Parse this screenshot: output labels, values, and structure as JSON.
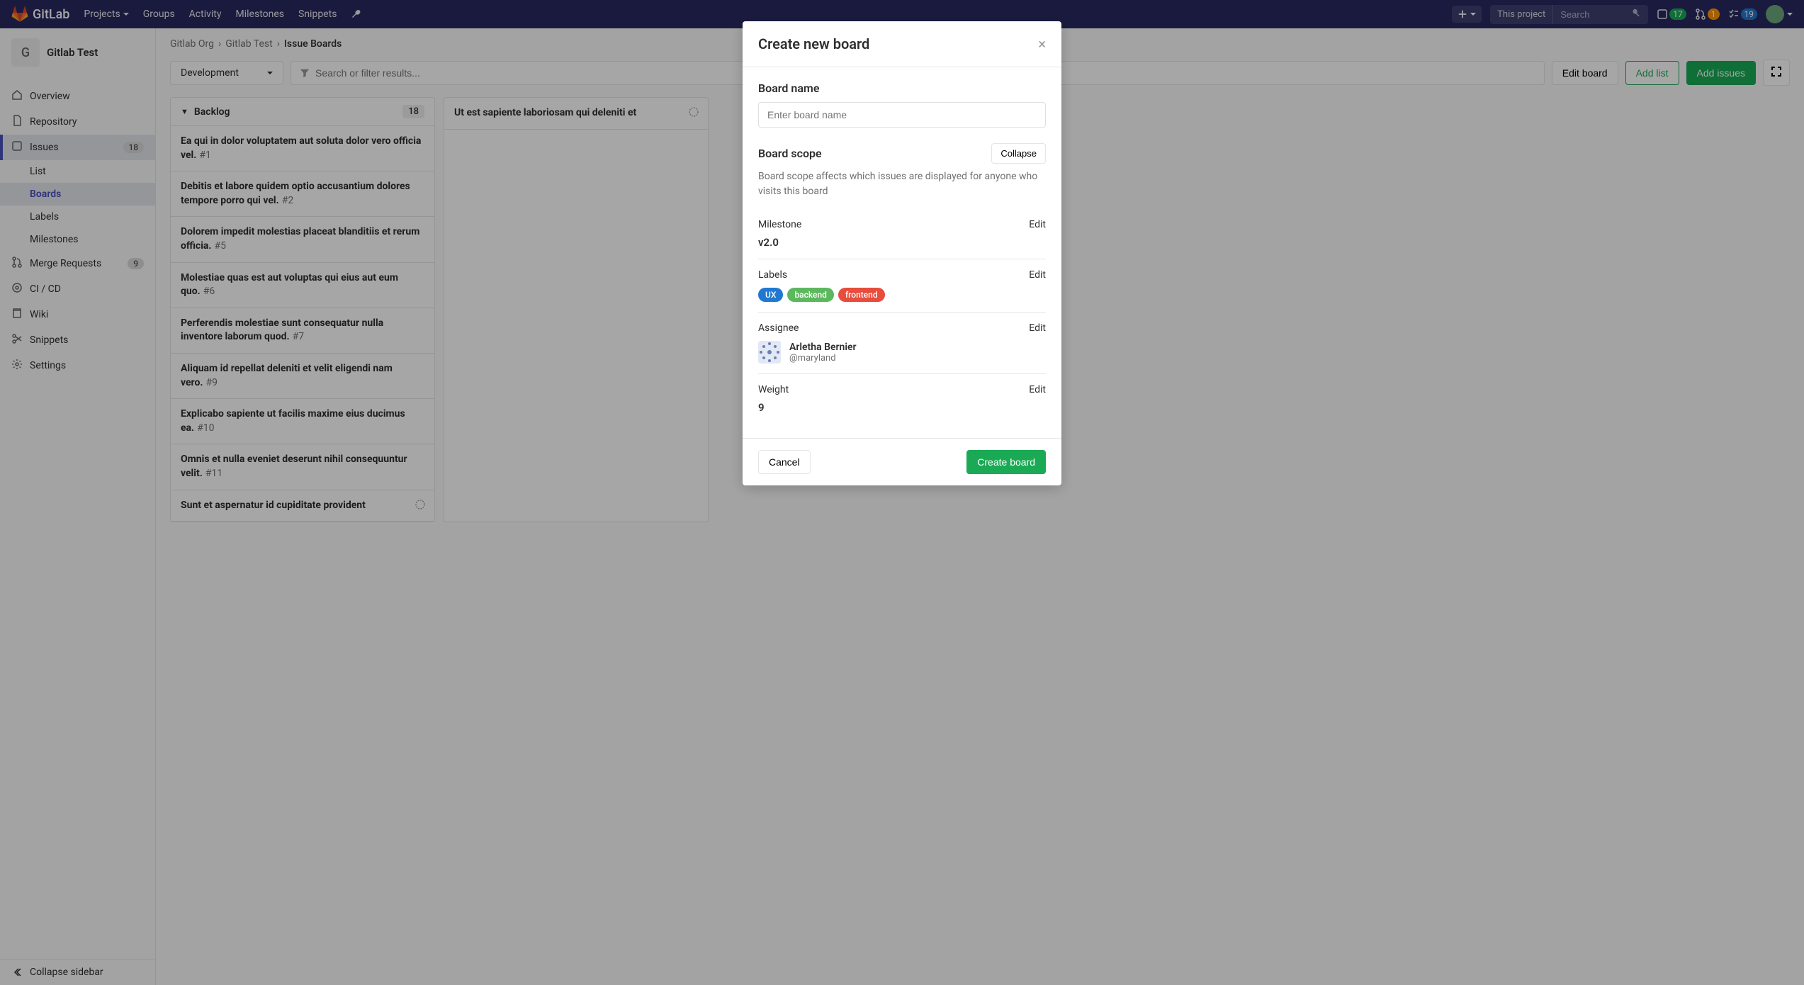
{
  "navbar": {
    "brand": "GitLab",
    "items": [
      "Projects",
      "Groups",
      "Activity",
      "Milestones",
      "Snippets"
    ],
    "search_scope": "This project",
    "search_placeholder": "Search",
    "badges": {
      "issues": "17",
      "merge": "1",
      "todos": "19"
    }
  },
  "sidebar": {
    "project_letter": "G",
    "project_name": "Gitlab Test",
    "items": [
      {
        "label": "Overview",
        "icon": "home"
      },
      {
        "label": "Repository",
        "icon": "doc"
      },
      {
        "label": "Issues",
        "icon": "issues",
        "count": "18",
        "active": true
      },
      {
        "label": "Merge Requests",
        "icon": "merge",
        "count": "9"
      },
      {
        "label": "CI / CD",
        "icon": "rocket"
      },
      {
        "label": "Wiki",
        "icon": "book"
      },
      {
        "label": "Snippets",
        "icon": "scissors"
      },
      {
        "label": "Settings",
        "icon": "gear"
      }
    ],
    "sub_items": [
      "List",
      "Boards",
      "Labels",
      "Milestones"
    ],
    "collapse": "Collapse sidebar"
  },
  "breadcrumb": {
    "org": "Gitlab Org",
    "project": "Gitlab Test",
    "page": "Issue Boards"
  },
  "toolbar": {
    "board_select": "Development",
    "filter_placeholder": "Search or filter results...",
    "edit": "Edit board",
    "add_list": "Add list",
    "add_issues": "Add issues"
  },
  "columns": [
    {
      "title": "Backlog",
      "count": "18",
      "cards": [
        {
          "title": "Ea qui in dolor voluptatem aut soluta dolor vero officia vel.",
          "ref": "#1"
        },
        {
          "title": "Debitis et labore quidem optio accusantium dolores tempore porro qui vel.",
          "ref": "#2"
        },
        {
          "title": "Dolorem impedit molestias placeat blanditiis et rerum officia.",
          "ref": "#5"
        },
        {
          "title": "Molestiae quas est aut voluptas qui eius aut eum quo.",
          "ref": "#6"
        },
        {
          "title": "Perferendis molestiae sunt consequatur nulla inventore laborum quod.",
          "ref": "#7"
        },
        {
          "title": "Aliquam id repellat deleniti et velit eligendi nam vero.",
          "ref": "#9"
        },
        {
          "title": "Explicabo sapiente ut facilis maxime eius ducimus ea.",
          "ref": "#10"
        },
        {
          "title": "Omnis et nulla eveniet deserunt nihil consequuntur velit.",
          "ref": "#11"
        },
        {
          "title": "Sunt et aspernatur id cupiditate provident",
          "ref": "",
          "conf": true
        }
      ]
    },
    {
      "title": "",
      "count": "",
      "cards": [
        {
          "title": "Ut est sapiente laboriosam qui deleniti et",
          "ref": "",
          "conf": true
        }
      ]
    }
  ],
  "modal": {
    "title": "Create new board",
    "board_name_label": "Board name",
    "board_name_placeholder": "Enter board name",
    "scope_label": "Board scope",
    "collapse_btn": "Collapse",
    "scope_desc": "Board scope affects which issues are displayed for anyone who visits this board",
    "milestone": {
      "label": "Milestone",
      "value": "v2.0",
      "edit": "Edit"
    },
    "labels": {
      "label": "Labels",
      "edit": "Edit",
      "items": [
        {
          "text": "UX",
          "color": "#1f78d1"
        },
        {
          "text": "backend",
          "color": "#5cb85c"
        },
        {
          "text": "frontend",
          "color": "#e74c3c"
        }
      ]
    },
    "assignee": {
      "label": "Assignee",
      "edit": "Edit",
      "name": "Arletha Bernier",
      "handle": "@maryland"
    },
    "weight": {
      "label": "Weight",
      "edit": "Edit",
      "value": "9"
    },
    "cancel": "Cancel",
    "create": "Create board"
  }
}
